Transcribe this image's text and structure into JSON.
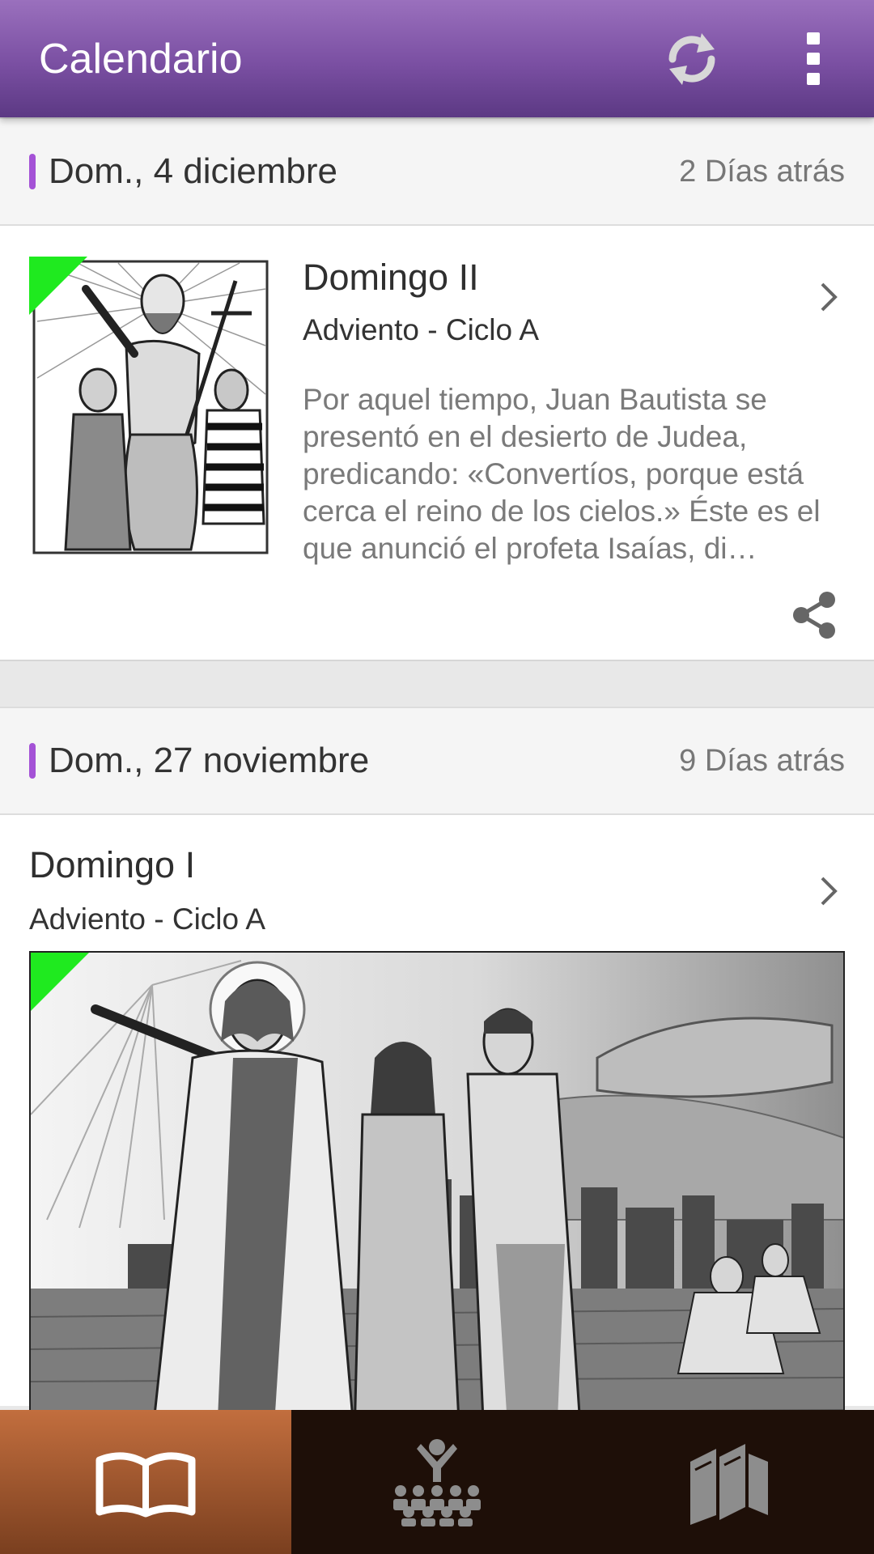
{
  "appbar": {
    "title": "Calendario",
    "refresh_icon": "refresh-icon",
    "more_icon": "more-vert-icon",
    "color": "#7a4fa2"
  },
  "sections": [
    {
      "date": "Dom., 4 diciembre",
      "ago": "2 Días atrás",
      "entry": {
        "title": "Domingo II",
        "subtitle": "Adviento - Ciclo A",
        "excerpt": "Por aquel tiempo, Juan Bautista se presentó en el desierto de Judea, predicando: «Convertíos, porque está cerca el reino de los cielos.» Éste es el que anunció el profeta Isaías, di…",
        "image": "illustration-john-baptist",
        "share_icon": "share-icon"
      }
    },
    {
      "date": "Dom., 27 noviembre",
      "ago": "9 Días atrás",
      "entry": {
        "title": "Domingo I",
        "subtitle": "Adviento - Ciclo A",
        "image": "illustration-jesus-noah-ark"
      }
    }
  ],
  "accent_color": "#a452d6",
  "new_marker_color": "#1fea1f",
  "bottom_nav": [
    {
      "name": "readings",
      "icon": "open-book-icon",
      "active": true
    },
    {
      "name": "community",
      "icon": "people-group-icon",
      "active": false
    },
    {
      "name": "library",
      "icon": "books-icon",
      "active": false
    }
  ]
}
